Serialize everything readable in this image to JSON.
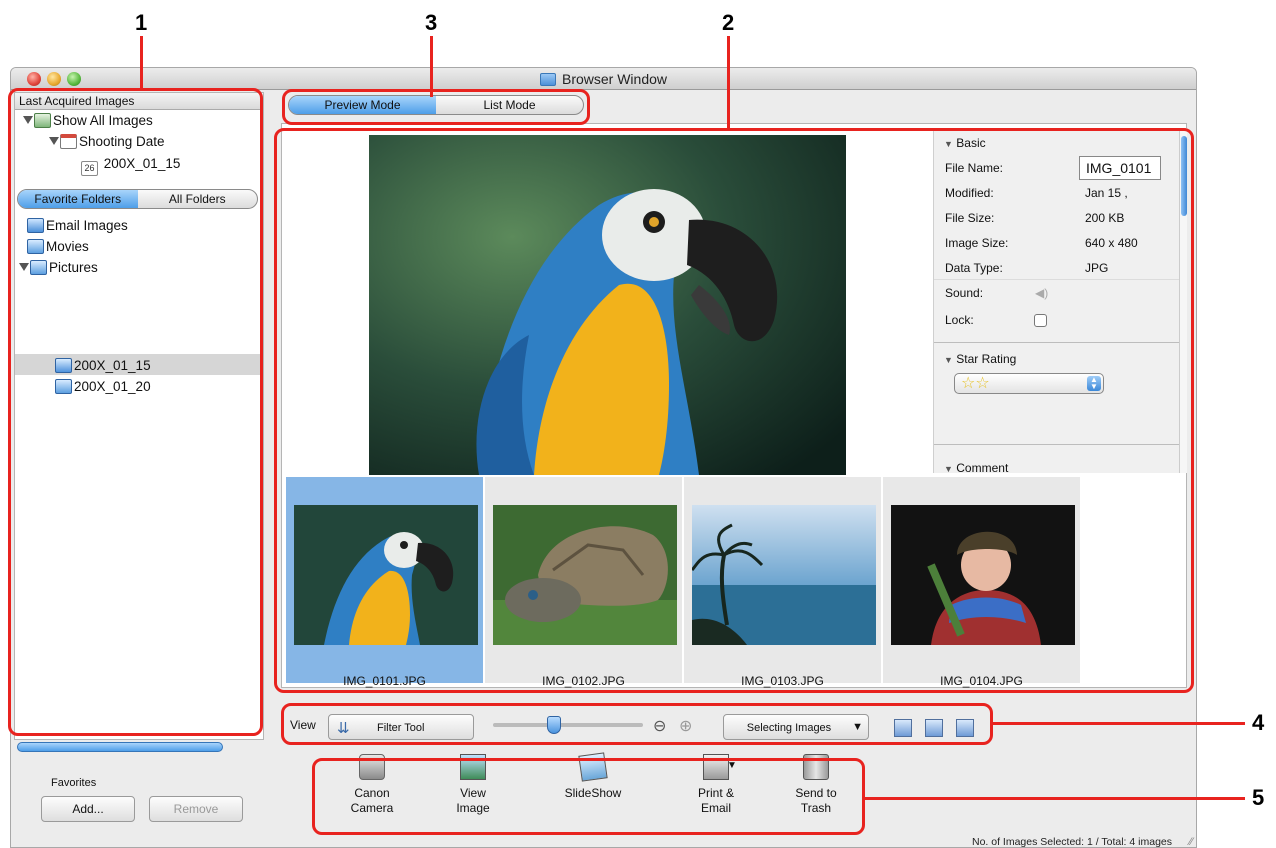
{
  "callouts": [
    "1",
    "2",
    "3",
    "4",
    "5"
  ],
  "window": {
    "title": "Browser Window"
  },
  "left_pane": {
    "header": "Last Acquired Images",
    "tree": [
      {
        "label": "Show All Images"
      },
      {
        "label": "Shooting Date"
      },
      {
        "label": "200X_01_15",
        "calendar_num": "26"
      }
    ],
    "folder_tabs": [
      "Favorite Folders",
      "All Folders"
    ],
    "folders": [
      {
        "label": "Email Images"
      },
      {
        "label": "Movies"
      },
      {
        "label": "Pictures"
      },
      {
        "label": "200X_01_15"
      },
      {
        "label": "200X_01_20"
      }
    ]
  },
  "favorites": {
    "label": "Favorites",
    "add_button": "Add...",
    "remove_button": "Remove"
  },
  "mode_tabs": [
    "Preview Mode",
    "List Mode"
  ],
  "info_panel": {
    "basic_header": "Basic",
    "fields": [
      {
        "label": "File Name:",
        "value": "IMG_0101"
      },
      {
        "label": "Modified:",
        "value": "Jan 15 ,"
      },
      {
        "label": "File Size:",
        "value": "200 KB"
      },
      {
        "label": "Image Size:",
        "value": "640 x 480"
      },
      {
        "label": "Data Type:",
        "value": "JPG"
      },
      {
        "label": "Sound:",
        "value": ""
      },
      {
        "label": "Lock:",
        "value": ""
      }
    ],
    "star_rating_header": "Star Rating",
    "star_rating_value": 2,
    "comment_header": "Comment"
  },
  "thumbnails": [
    {
      "name": "IMG_0101.JPG",
      "subject": "parrot",
      "selected": true
    },
    {
      "name": "IMG_0102.JPG",
      "subject": "tortoise",
      "selected": false
    },
    {
      "name": "IMG_0103.JPG",
      "subject": "seascape",
      "selected": false
    },
    {
      "name": "IMG_0104.JPG",
      "subject": "child",
      "selected": false
    }
  ],
  "view_toolbar": {
    "view_label": "View",
    "filter_button": "Filter Tool",
    "selecting_menu": "Selecting Images",
    "zoom_level": 0.4
  },
  "actions": [
    {
      "line1": "Canon",
      "line2": "Camera",
      "icon": "camera-icon"
    },
    {
      "line1": "View",
      "line2": "Image",
      "icon": "picture-icon"
    },
    {
      "line1": "SlideShow",
      "line2": "",
      "icon": "slideshow-icon"
    },
    {
      "line1": "Print &",
      "line2": "Email",
      "icon": "printer-icon"
    },
    {
      "line1": "Send to",
      "line2": "Trash",
      "icon": "trash-icon"
    }
  ],
  "status_bar": "No. of Images Selected: 1 / Total: 4 images",
  "colors": {
    "callout": "#e8231f",
    "selection": "#86b6e6",
    "tab_active": "#4e9ee9"
  }
}
